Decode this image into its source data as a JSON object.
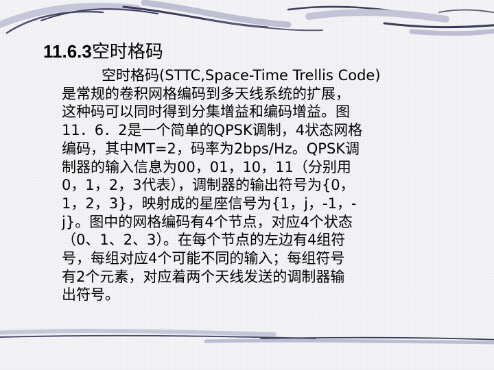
{
  "slide": {
    "heading_number": "11.6.3",
    "heading_title": "空时格码",
    "body_lines": [
      "空时格码(STTC,Space-Time Trellis Code)",
      "是常规的卷积网格编码到多天线系统的扩展，",
      "这种码可以同时得到分集增益和编码增益。图",
      "11．6．2是一个简单的QPSK调制，4状态网格",
      "编码，其中MT=2，码率为2bps/Hz。QPSK调",
      "制器的输入信息为00，01，10，11（分别用",
      "0，1，2，3代表），调制器的输出符号为{0，",
      "1，2，3}，映射成的星座信号为{1，j，-1，-",
      "j}。图中的网格编码有4个节点，对应4个状态",
      "（0、1、2、3）。在每个节点的左边有4组符",
      "号，每组对应4个可能不同的输入；每组符号",
      "有2个元素，对应着两个天线发送的调制器输",
      "出符号。"
    ]
  },
  "theme": {
    "stroke_dark": "#3a3a5a",
    "stroke_light": "#b8b8d0",
    "background": "#f3f3f6",
    "text": "#000000"
  }
}
